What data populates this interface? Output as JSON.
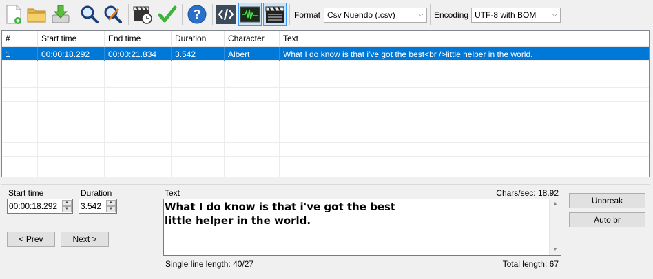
{
  "toolbar": {
    "icons": [
      "new-file-icon",
      "open-folder-icon",
      "save-download-icon",
      "find-icon",
      "replace-icon",
      "video-clock-icon",
      "spell-check-icon",
      "help-icon",
      "source-view-icon",
      "waveform-icon",
      "video-player-icon"
    ],
    "format_label": "Format",
    "format_value": "Csv Nuendo (.csv)",
    "encoding_label": "Encoding",
    "encoding_value": "UTF-8 with BOM"
  },
  "grid": {
    "columns": [
      "#",
      "Start time",
      "End time",
      "Duration",
      "Character",
      "Text"
    ],
    "rows": [
      {
        "num": "1",
        "start": "00:00:18.292",
        "end": "00:00:21.834",
        "duration": "3.542",
        "character": "Albert",
        "text": "What I do know is that i've got the best<br />little helper in the world."
      }
    ]
  },
  "editor": {
    "start_time_label": "Start time",
    "start_time_value": "00:00:18.292",
    "duration_label": "Duration",
    "duration_value": "3.542",
    "text_label": "Text",
    "chars_sec": "Chars/sec: 18.92",
    "text_line1": "What I do know is that i've got the best",
    "text_line2": "little helper in the world.",
    "single_line_length": "Single line length: 40/27",
    "total_length": "Total length: 67",
    "prev_label": "< Prev",
    "next_label": "Next >",
    "unbreak_label": "Unbreak",
    "auto_br_label": "Auto br"
  },
  "colors": {
    "selection": "#0078d7",
    "accent_green": "#3cb33c",
    "help_blue": "#2a6fc9"
  }
}
